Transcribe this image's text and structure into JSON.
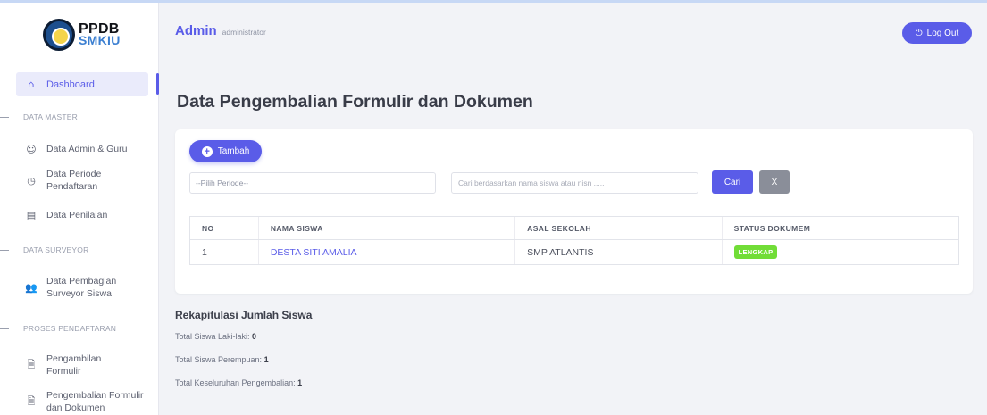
{
  "app": {
    "logo_main": "PPDB",
    "logo_sub": "SMKIU"
  },
  "header": {
    "admin_name": "Admin",
    "admin_role": "administrator",
    "logout_icon": "power-icon",
    "logout_label": "Log Out"
  },
  "sidebar": {
    "dashboard": {
      "label": "Dashboard",
      "icon": "home-icon"
    },
    "sections": {
      "master": "DATA MASTER",
      "surveyor": "DATA SURVEYOR",
      "proses": "PROSES PENDAFTARAN"
    },
    "items": {
      "admin_guru": {
        "label": "Data Admin & Guru",
        "icon": "user-circle-icon"
      },
      "periode": {
        "label": "Data Periode Pendaftaran",
        "icon": "clock-icon"
      },
      "penilaian": {
        "label": "Data Penilaian",
        "icon": "document-icon"
      },
      "pembagian": {
        "label": "Data Pembagian Surveyor Siswa",
        "icon": "users-icon"
      },
      "pengambilan": {
        "label": "Pengambilan Formulir",
        "icon": "file-icon"
      },
      "pengembalian": {
        "label": "Pengembalian Formulir dan Dokumen",
        "icon": "file-icon"
      }
    }
  },
  "page": {
    "title": "Data Pengembalian Formulir dan Dokumen"
  },
  "toolbar": {
    "add_label": "Tambah",
    "period_select": "--Pilih Periode--",
    "search_placeholder": "Cari berdasarkan nama siswa atau nisn .....",
    "search_button": "Cari",
    "clear_button": "X"
  },
  "table": {
    "headers": [
      "NO",
      "NAMA SISWA",
      "ASAL SEKOLAH",
      "STATUS DOKUMEM"
    ],
    "rows": [
      {
        "no": "1",
        "nama": "DESTA SITI AMALIA",
        "sekolah": "SMP ATLANTIS",
        "status": "LENGKAP"
      }
    ]
  },
  "recap": {
    "title": "Rekapitulasi Jumlah Siswa",
    "male_label": "Total Siswa Laki-laki:",
    "male_value": "0",
    "female_label": "Total Siswa Perempuan:",
    "female_value": "1",
    "total_label": "Total Keseluruhan Pengembalian:",
    "total_value": "1"
  },
  "colors": {
    "accent": "#5a5ce8",
    "badge_success": "#71dd37",
    "secondary_button": "#8a8e99"
  }
}
